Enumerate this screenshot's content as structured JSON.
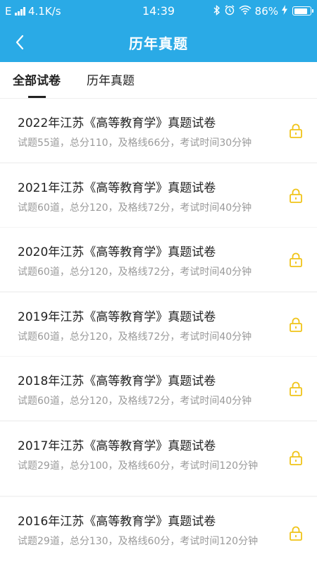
{
  "status_bar": {
    "network": "E",
    "speed": "4.1K/s",
    "time": "14:39",
    "bluetooth_icon": "bluetooth-icon",
    "alarm_icon": "alarm-icon",
    "wifi_icon": "wifi-icon",
    "battery": "86%",
    "battery_level": 0.86
  },
  "header": {
    "title": "历年真题",
    "back_icon": "chevron-left-icon",
    "background_color": "#2aaae6"
  },
  "tabs": [
    {
      "label": "全部试卷",
      "active": true
    },
    {
      "label": "历年真题",
      "active": false
    }
  ],
  "papers": [
    {
      "title": "2022年江苏《高等教育学》真题试卷",
      "meta": "试题55道，总分110，及格线66分，考试时间30分钟",
      "icon": "lock-icon"
    },
    {
      "title": "2021年江苏《高等教育学》真题试卷",
      "meta": "试题60道，总分120，及格线72分，考试时间40分钟",
      "icon": "lock-icon"
    },
    {
      "title": "2020年江苏《高等教育学》真题试卷",
      "meta": "试题60道，总分120，及格线72分，考试时间40分钟",
      "icon": "lock-icon"
    },
    {
      "title": "2019年江苏《高等教育学》真题试卷",
      "meta": "试题60道，总分120，及格线72分，考试时间40分钟",
      "icon": "lock-icon"
    },
    {
      "title": "2018年江苏《高等教育学》真题试卷",
      "meta": "试题60道，总分120，及格线72分，考试时间40分钟",
      "icon": "lock-icon"
    },
    {
      "title": "2017年江苏《高等教育学》真题试卷",
      "meta": "试题29道，总分100，及格线60分，考试时间120分钟",
      "icon": "lock-icon"
    },
    {
      "title": "2016年江苏《高等教育学》真题试卷",
      "meta": "试题29道，总分130，及格线60分，考试时间120分钟",
      "icon": "lock-icon"
    }
  ],
  "colors": {
    "accent": "#2aaae6",
    "lock": "#f0c419",
    "meta_text": "#9a9a9a"
  }
}
